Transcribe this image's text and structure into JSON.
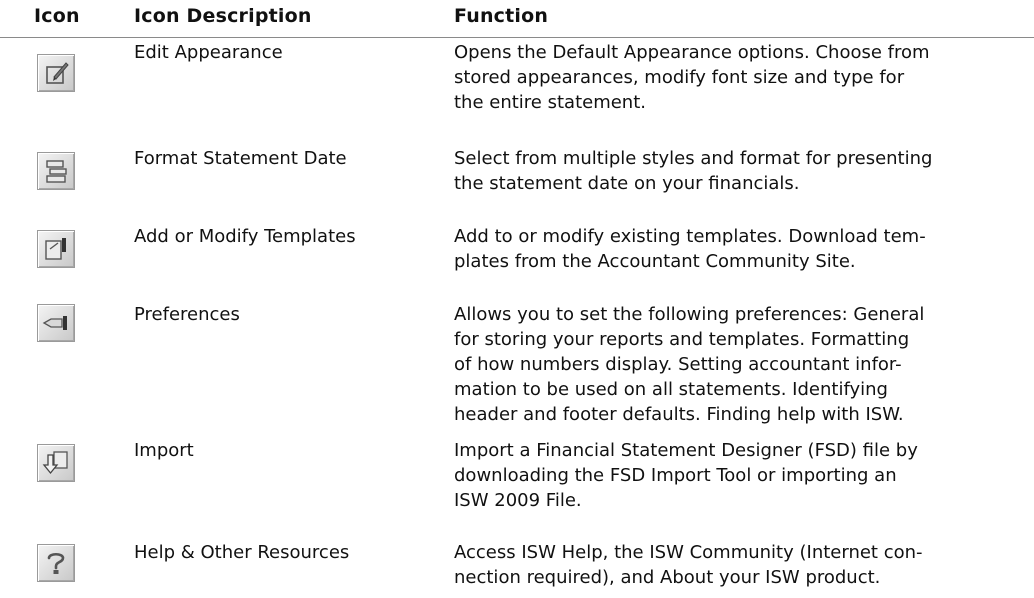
{
  "header": {
    "icon": "Icon",
    "description": "Icon Description",
    "function": "Function"
  },
  "rows": [
    {
      "icon": "edit-appearance-icon",
      "description": "Edit Appearance",
      "function_lines": [
        "Opens the Default Appearance options. Choose from",
        "stored appearances, modify font size and type for",
        "the entire statement."
      ]
    },
    {
      "icon": "format-statement-date-icon",
      "description": "Format Statement Date",
      "function_lines": [
        "Select from multiple styles and format for presenting",
        "the statement date on your financials."
      ]
    },
    {
      "icon": "templates-icon",
      "description": "Add or Modify Templates",
      "function_lines": [
        "Add to or modify existing templates. Download tem-",
        "plates from the Accountant Community Site."
      ]
    },
    {
      "icon": "preferences-icon",
      "description": "Preferences",
      "function_lines": [
        "Allows you to set the following preferences: General",
        "for storing your reports and templates. Formatting",
        "of how numbers display. Setting accountant infor-",
        "mation to be used on all statements. Identifying",
        "header and footer defaults. Finding help with ISW."
      ]
    },
    {
      "icon": "import-icon",
      "description": "Import",
      "function_lines": [
        "Import a Financial Statement Designer (FSD) file by",
        "downloading the FSD Import Tool or importing an",
        "ISW 2009 File."
      ]
    },
    {
      "icon": "help-icon",
      "description": "Help & Other Resources",
      "function_lines": [
        "Access ISW Help, the ISW Community (Internet con-",
        "nection required), and About your ISW product."
      ]
    }
  ]
}
